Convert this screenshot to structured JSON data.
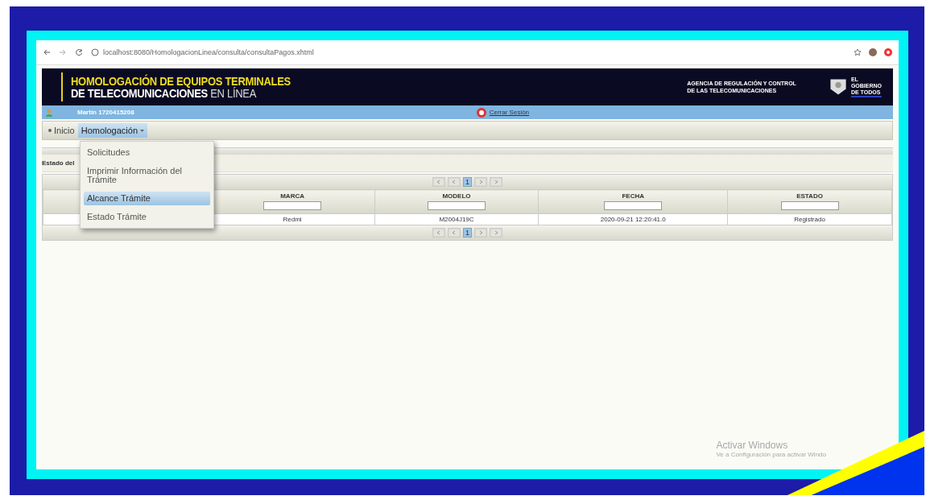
{
  "browser": {
    "url": "localhost:8080/HomologacionLinea/consulta/consultaPagos.xhtml"
  },
  "banner": {
    "title_line1": "HOMOLOGACIÓN DE EQUIPOS TERMINALES",
    "title_line2": "DE TELECOMUNICACIONES",
    "title_suffix": "EN LÍNEA",
    "agency": [
      "AGENCIA DE REGULACIÓN Y CONTROL",
      "DE LAS TELECOMUNICACIONES"
    ],
    "gov_logo": [
      "EL",
      "GOBIERNO",
      "DE TODOS"
    ]
  },
  "user_bar": {
    "user": "Martin 1720415208",
    "logout": "Cerrar Sesión"
  },
  "menu": [
    {
      "label": "Inicio",
      "selected": false,
      "kind": "link"
    },
    {
      "label": "Homologación",
      "selected": true,
      "kind": "dropdown"
    }
  ],
  "dropdown": [
    {
      "label": "Solicitudes",
      "selected": false
    },
    {
      "label": "Imprimir Información del Trámite",
      "selected": false
    },
    {
      "label": "Alcance Trámite",
      "selected": true
    },
    {
      "label": "Estado Trámite",
      "selected": false
    }
  ],
  "section_title": "Estado del",
  "table": {
    "pager_top_page": "1",
    "pager_bottom_page": "1",
    "columns": [
      "MARCA",
      "MODELO",
      "FECHA",
      "ESTADO"
    ],
    "rows": [
      [
        "Redmi",
        "M2004J19C",
        "2020-09-21 12:20:41.0",
        "Registrado"
      ]
    ]
  },
  "os_watermark": {
    "title": "Activar Windows",
    "text": "Ve a Configuración para activar Windo"
  }
}
